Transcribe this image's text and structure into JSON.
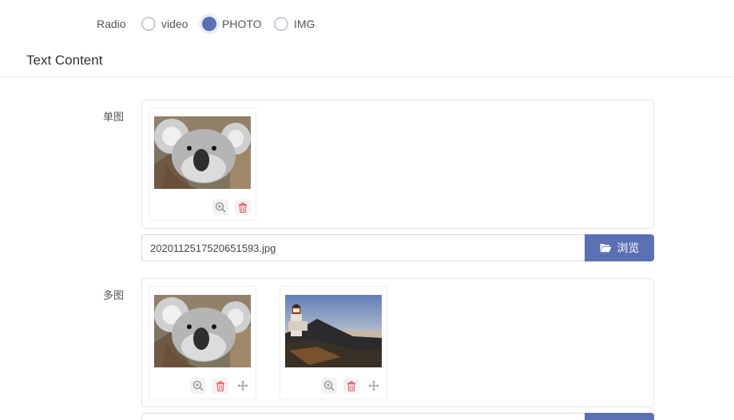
{
  "radio": {
    "label": "Radio",
    "options": [
      {
        "label": "video",
        "checked": false
      },
      {
        "label": "PHOTO",
        "checked": true
      },
      {
        "label": "IMG",
        "checked": false
      }
    ]
  },
  "section": {
    "title": "Text Content"
  },
  "single_image": {
    "label": "单图",
    "filename": "2020112517520651593.jpg",
    "browse_label": "浏览",
    "images": [
      {
        "subject": "koala"
      }
    ]
  },
  "multi_image": {
    "label": "多图",
    "images": [
      {
        "subject": "koala"
      },
      {
        "subject": "lighthouse"
      }
    ]
  },
  "colors": {
    "accent": "#5a6fb4",
    "delete": "#e5677a",
    "icon_gray": "#9aa0a6"
  }
}
